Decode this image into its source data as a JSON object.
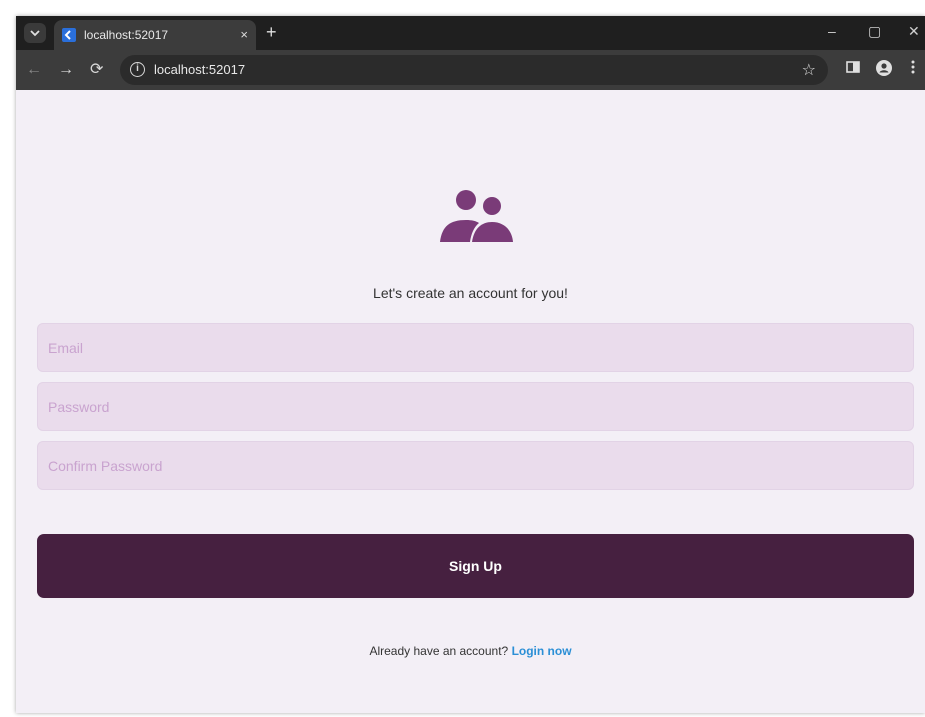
{
  "browser": {
    "tab_title": "localhost:52017",
    "tab_close": "×",
    "new_tab": "+",
    "url": "localhost:52017",
    "controls": {
      "minimize": "–",
      "maximize": "▢",
      "close": "✕"
    },
    "nav": {
      "back": "←",
      "forward": "→",
      "reload": "⟳"
    },
    "icons": [
      "tab-search-icon",
      "flutter-favicon-icon",
      "info-icon",
      "bookmark-star-icon",
      "side-panel-icon",
      "profile-icon",
      "kebab-menu-icon"
    ]
  },
  "app": {
    "logo_icon": "people-icon",
    "tagline": "Let's create an account for you!",
    "fields": {
      "email_placeholder": "Email",
      "password_placeholder": "Password",
      "confirm_placeholder": "Confirm Password"
    },
    "signup_label": "Sign Up",
    "footer_prompt": "Already have an account?",
    "login_link": "Login now"
  },
  "colors": {
    "background": "#f3eff6",
    "field_fill": "#eadcec",
    "placeholder": "#c9a3cf",
    "primary": "#462040",
    "logo": "#7a3b78",
    "link": "#2b8fd6"
  }
}
